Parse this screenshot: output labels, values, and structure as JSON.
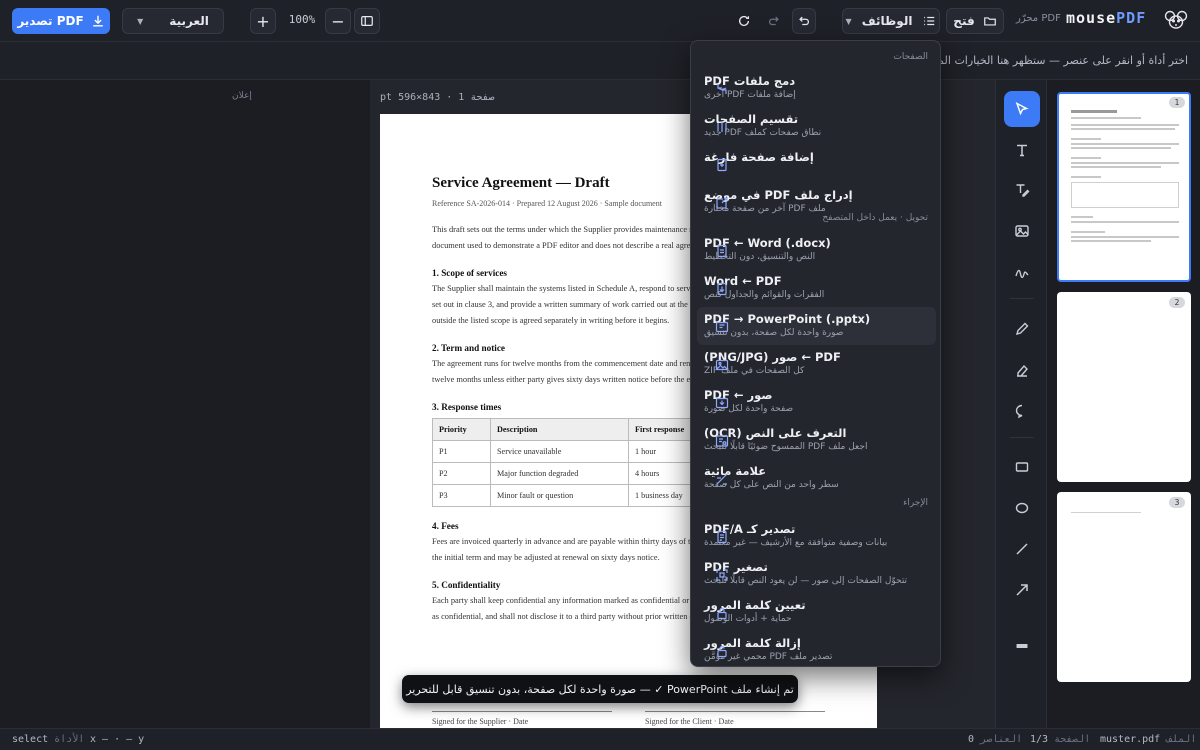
{
  "toolbar": {
    "export_label": "تصدير PDF",
    "language": "العربية",
    "zoom": "100%",
    "functions_label": "الوظائف",
    "open_label": "فتح",
    "editor_label": "محرّر PDF",
    "logo_mouse": "mouse",
    "logo_pdf": "PDF",
    "accent_color": "#3d7af5"
  },
  "hint": "اختر أداة أو انقر على عنصر — ستظهر هنا الخيارات المرتبطة بالعنصر المحدد",
  "left_panel": {
    "ad_label": "إعلان"
  },
  "canvas": {
    "page_label": "صفحة 1",
    "page_size": "843×596 pt"
  },
  "document": {
    "title": "Service Agreement — Draft",
    "reference": "Reference SA-2026-014 · Prepared 12 August 2026 · Sample document",
    "intro": "This draft sets out the terms under which the Supplier provides maintenance services to the Client. It is a sample document used to demonstrate a PDF editor and does not describe a real agreement between real parties.",
    "sections": [
      {
        "heading": "1. Scope of services",
        "text": "The Supplier shall maintain the systems listed in Schedule A, respond to service requests within the response times set out in clause 3, and provide a written summary of work carried out at the end of each calendar quarter. Work outside the listed scope is agreed separately in writing before it begins."
      },
      {
        "heading": "2. Term and notice",
        "text": "The agreement runs for twelve months from the commencement date and renews automatically for further periods of twelve months unless either party gives sixty days written notice before the end of the current term."
      },
      {
        "heading": "3. Response times"
      },
      {
        "heading": "4. Fees",
        "text": "Fees are invoiced quarterly in advance and are payable within thirty days of the invoice date. The fees are held for the initial term and may be adjusted at renewal on sixty days notice."
      },
      {
        "heading": "5. Confidentiality",
        "text": "Each party shall keep confidential any information marked as confidential or which a reasonable person would treat as confidential, and shall not disclose it to a third party without prior written consent of the other party."
      }
    ],
    "table": {
      "headers": [
        "Priority",
        "Description",
        "First response"
      ],
      "rows": [
        [
          "P1",
          "Service unavailable",
          "1 hour"
        ],
        [
          "P2",
          "Major function degraded",
          "4 hours"
        ],
        [
          "P3",
          "Minor fault or question",
          "1 business day"
        ]
      ]
    },
    "signatures": [
      "Signed for the Supplier · Date",
      "Signed for the Client · Date"
    ]
  },
  "toast": "تم إنشاء ملف PowerPoint ✓ — صورة واحدة لكل صفحة، بدون تنسيق قابل للتحرير",
  "menu": {
    "sections": [
      "الصفحات",
      "تحويل · يعمل داخل المتصفح",
      "الإجراء"
    ],
    "items": [
      {
        "title": "دمج ملفات PDF",
        "sub": "إضافة ملفات PDF أخرى",
        "icon": "merge-icon"
      },
      {
        "title": "تقسيم الصفحات",
        "sub": "نطاق صفحات كملف PDF جديد",
        "icon": "split-icon"
      },
      {
        "title": "إضافة صفحة فارغة",
        "sub": "",
        "icon": "page-plus-icon"
      },
      {
        "title": "إدراج ملف PDF في موضع",
        "sub": "ملف PDF آخر من صفحة مختارة",
        "icon": "insert-icon"
      },
      {
        "title": "PDF ← Word (.docx)",
        "sub": "النص والتنسيق، دون التخطيط",
        "icon": "word-icon"
      },
      {
        "title": "Word ← PDF",
        "sub": "الفقرات والقوائم والجداول كنص",
        "icon": "pdf-icon"
      },
      {
        "title": "PDF → PowerPoint (.pptx)",
        "sub": "صورة واحدة لكل صفحة، بدون تنسيق",
        "icon": "slides-icon"
      },
      {
        "title": "PDF ← صور (PNG/JPG)",
        "sub": "كل الصفحات في ملف ZIP",
        "icon": "image-icon"
      },
      {
        "title": "صور ← PDF",
        "sub": "صفحة واحدة لكل صورة",
        "icon": "image-import-icon"
      },
      {
        "title": "التعرف على النص (OCR)",
        "sub": "اجعل ملف PDF الممسوح ضوئيًا قابلًا للبحث",
        "icon": "ocr-icon"
      },
      {
        "title": "علامة مائية",
        "sub": "سطر واحد من النص على كل صفحة",
        "icon": "watermark-icon"
      },
      {
        "title": "تصدير كـ PDF/A",
        "sub": "بيانات وصفية متوافقة مع الأرشيف — غير معتمدة",
        "icon": "archive-icon"
      },
      {
        "title": "تصغير PDF",
        "sub": "تتحوّل الصفحات إلى صور — لن يعود النص قابلًا للبحث",
        "icon": "compress-icon"
      },
      {
        "title": "تعيين كلمة المرور",
        "sub": "حماية + أدوات الوصول",
        "icon": "lock-icon"
      },
      {
        "title": "إزالة كلمة المرور",
        "sub": "تصدير ملف PDF محمي غير مؤمَّن",
        "icon": "unlock-icon"
      }
    ]
  },
  "thumbnails": [
    "1",
    "2",
    "3"
  ],
  "status": {
    "tool_label": "الأداة",
    "tool_value": "select",
    "coords": "x — · — y",
    "file_label": "الملف",
    "file_value": "muster.pdf",
    "page_label": "الصفحة",
    "page_value": "1/3",
    "elements_label": "العناصر",
    "elements_value": "0"
  }
}
